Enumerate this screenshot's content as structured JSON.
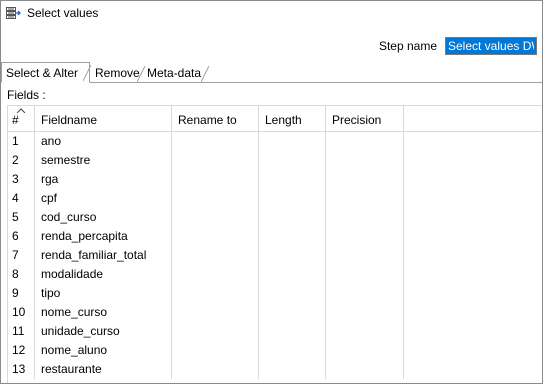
{
  "window": {
    "title": "Select values"
  },
  "step_name": {
    "label": "Step name",
    "value": "Select values DW"
  },
  "tabs": [
    {
      "label": "Select & Alter",
      "active": true
    },
    {
      "label": "Remove",
      "active": false
    },
    {
      "label": "Meta-data",
      "active": false
    }
  ],
  "fields_label": "Fields :",
  "table": {
    "columns": [
      "#",
      "Fieldname",
      "Rename to",
      "Length",
      "Precision"
    ],
    "rows": [
      {
        "num": "1",
        "fieldname": "ano",
        "rename": "",
        "length": "",
        "precision": ""
      },
      {
        "num": "2",
        "fieldname": "semestre",
        "rename": "",
        "length": "",
        "precision": ""
      },
      {
        "num": "3",
        "fieldname": "rga",
        "rename": "",
        "length": "",
        "precision": ""
      },
      {
        "num": "4",
        "fieldname": "cpf",
        "rename": "",
        "length": "",
        "precision": ""
      },
      {
        "num": "5",
        "fieldname": "cod_curso",
        "rename": "",
        "length": "",
        "precision": ""
      },
      {
        "num": "6",
        "fieldname": "renda_percapita",
        "rename": "",
        "length": "",
        "precision": ""
      },
      {
        "num": "7",
        "fieldname": "renda_familiar_total",
        "rename": "",
        "length": "",
        "precision": ""
      },
      {
        "num": "8",
        "fieldname": "modalidade",
        "rename": "",
        "length": "",
        "precision": ""
      },
      {
        "num": "9",
        "fieldname": "tipo",
        "rename": "",
        "length": "",
        "precision": ""
      },
      {
        "num": "10",
        "fieldname": "nome_curso",
        "rename": "",
        "length": "",
        "precision": ""
      },
      {
        "num": "11",
        "fieldname": "unidade_curso",
        "rename": "",
        "length": "",
        "precision": ""
      },
      {
        "num": "12",
        "fieldname": "nome_aluno",
        "rename": "",
        "length": "",
        "precision": ""
      },
      {
        "num": "13",
        "fieldname": "restaurante",
        "rename": "",
        "length": "",
        "precision": ""
      }
    ]
  },
  "colors": {
    "selection": "#0078d7",
    "grid_line": "#d9d9d9",
    "border": "#8a8a8a"
  }
}
